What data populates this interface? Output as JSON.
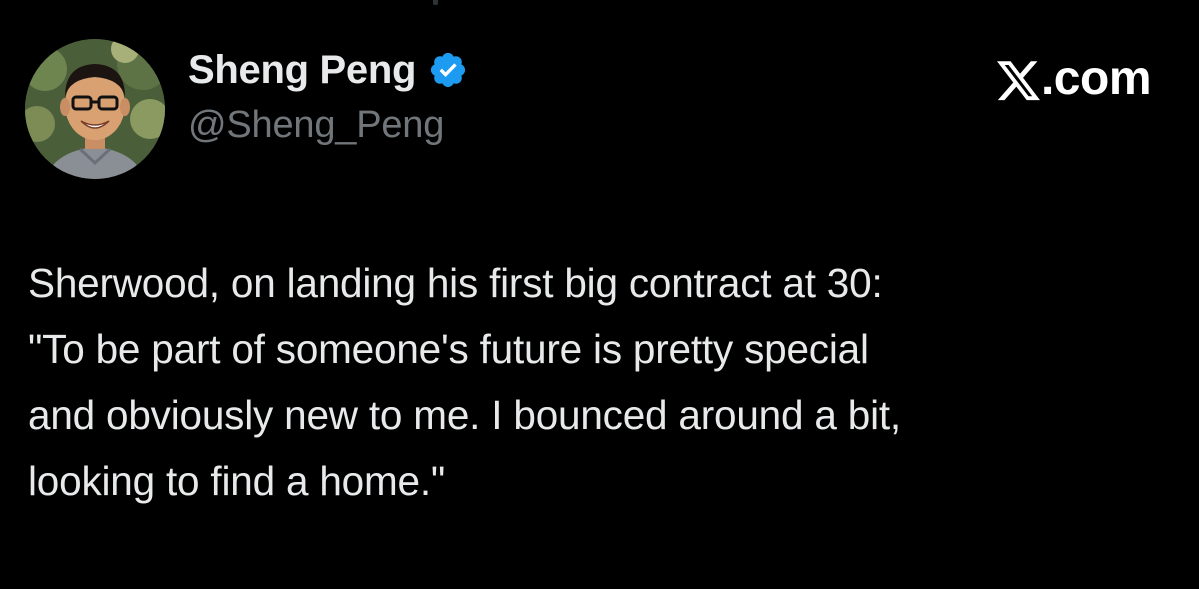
{
  "author": {
    "name": "Sheng Peng",
    "handle": "@Sheng_Peng",
    "verified": true,
    "verified_color": "#1d9bf0",
    "avatar_icon": "person-with-glasses-avatar"
  },
  "site": {
    "logo_icon": "x-logo-icon",
    "suffix": ".com"
  },
  "tweet": {
    "lines": [
      "Sherwood, on landing his first big contract at 30:",
      "\"To be part of someone's future is pretty special",
      "and obviously new to me. I bounced around a bit,",
      "looking to find a home.\""
    ]
  },
  "colors": {
    "background": "#000000",
    "text_primary": "#e7e9ea",
    "text_secondary": "#71767b"
  }
}
